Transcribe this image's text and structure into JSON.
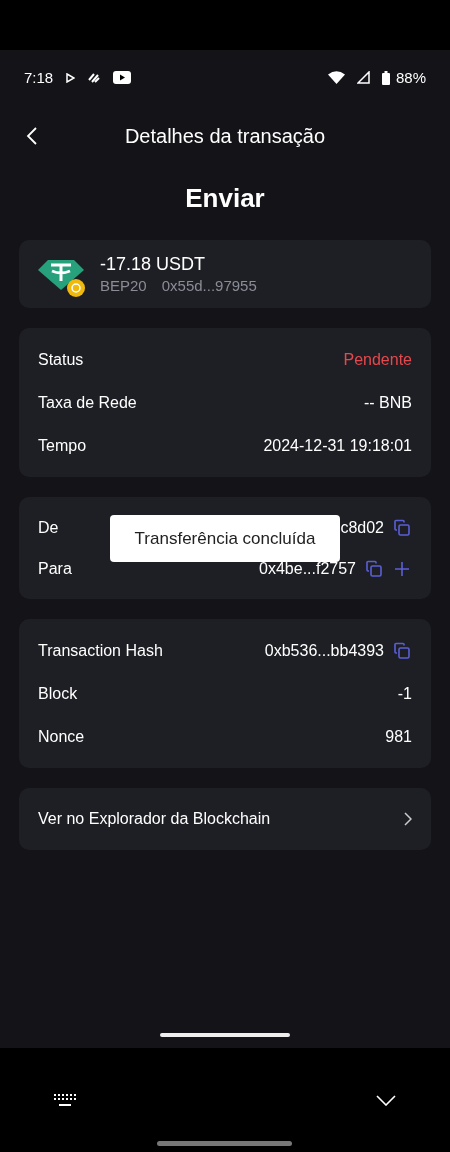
{
  "status_bar": {
    "time": "7:18",
    "battery": "88%"
  },
  "header": {
    "title": "Detalhes da transação"
  },
  "heading": "Enviar",
  "token": {
    "amount": "-17.18 USDT",
    "network": "BEP20",
    "address": "0x55d...97955"
  },
  "details": [
    {
      "label": "Status",
      "value": "Pendente",
      "kind": "status"
    },
    {
      "label": "Taxa de Rede",
      "value": "-- BNB",
      "kind": "plain"
    },
    {
      "label": "Tempo",
      "value": "2024-12-31 19:18:01",
      "kind": "plain"
    }
  ],
  "parties": [
    {
      "label": "De",
      "value": "c8d02",
      "copyable": true,
      "addable": false
    },
    {
      "label": "Para",
      "value": "0x4be...f2757",
      "copyable": true,
      "addable": true
    }
  ],
  "toast": "Transferência concluída",
  "chain": [
    {
      "label": "Transaction Hash",
      "value": "0xb536...bb4393",
      "copyable": true
    },
    {
      "label": "Block",
      "value": "-1",
      "copyable": false
    },
    {
      "label": "Nonce",
      "value": "981",
      "copyable": false
    }
  ],
  "explorer_link": "Ver no Explorador da Blockchain"
}
